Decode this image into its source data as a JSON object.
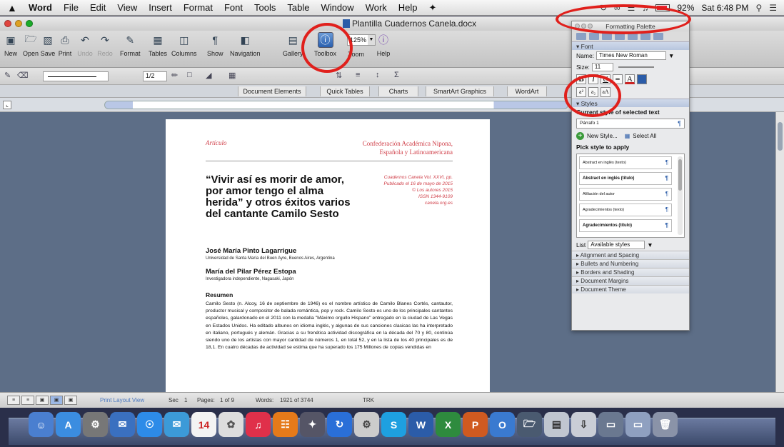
{
  "menubar": {
    "app": "Word",
    "items": [
      "File",
      "Edit",
      "View",
      "Insert",
      "Format",
      "Font",
      "Tools",
      "Table",
      "Window",
      "Work",
      "Help"
    ],
    "battery": "92%",
    "clock": "Sat 6:48 PM"
  },
  "window": {
    "title": "Plantilla Cuadernos Canela.docx"
  },
  "toolbar": {
    "new": "New",
    "open": "Open",
    "save": "Save",
    "print": "Print",
    "undo": "Undo",
    "redo": "Redo",
    "format": "Format",
    "tables": "Tables",
    "columns": "Columns",
    "show": "Show",
    "navigation": "Navigation",
    "gallery": "Gallery",
    "toolbox": "Toolbox",
    "zoom": "Zoom",
    "zoom_value": "125%",
    "help": "Help"
  },
  "fmtbar": {
    "point_size": "1/2"
  },
  "ribbon_tabs": [
    "Document Elements",
    "Quick Tables",
    "Charts",
    "SmartArt Graphics",
    "WordArt"
  ],
  "document": {
    "header_left": "Artículo",
    "header_right_1": "Confederación Académica Nipona,",
    "header_right_2": "Española y Latinoamericana",
    "title": "“Vivir así es morir de amor, por amor tengo el alma herida” y otros éxitos varios del cantante Camilo Sesto",
    "pub_1": "Cuadernos Canela Vol. XXVI, pp.",
    "pub_2": "Publicado el 16 de mayo de 2015",
    "pub_3": "© Los autores 2015",
    "pub_4": "ISSN 1344-9109",
    "pub_5": "canela.org.es",
    "author1": "José María Pinto Lagarrigue",
    "affil1": "Universidad de Santa María del Buen Ayre, Buenos Aires, Argentina",
    "author2": "María del Pilar Pérez Estopa",
    "affil2": "Investigadora independiente, Nagasaki, Japón",
    "abstract_heading": "Resumen",
    "abstract": "Camilo Sesto (n. Alcoy, 16 de septiembre de 1946) es el nombre artístico de Camilo Blanes Cortés, cantautor, productor musical y compositor de balada romántica, pop y rock. Camilo Sesto es uno de los principales cantantes españoles, galardonado en el 2011 con la medalla \"Máximo orgullo Hispano\" entregado en la ciudad de Las Vegas en Estados Unidos. Ha editado albunes en idioma inglés, y algunas de sus canciones clasicas las ha interpretado en italiano, portugués y alemán. Gracias a su frenética actividad discográfica en la década del 70 y 80, continúa siendo uno de los artistas con mayor cantidad de números 1, en total 52, y en la lista de los 40 principales es de 18,1. En cuatro décadas de actividad se estima que ha superado los 175 Millones de copias vendidas en"
  },
  "statusbar": {
    "view": "Print Layout View",
    "sec_label": "Sec",
    "sec": "1",
    "pages_label": "Pages:",
    "pages": "1 of 9",
    "words_label": "Words:",
    "words": "1921 of 3744",
    "trk": "TRK"
  },
  "palette": {
    "title": "Formatting Palette",
    "font_section": "Font",
    "name_label": "Name:",
    "font_name": "Times New Roman",
    "size_label": "Size:",
    "font_size": "11",
    "bold": "B",
    "italic": "I",
    "underline": "U",
    "styles_section": "Styles",
    "current_style_label": "Current style of selected text",
    "current_style": "Párrafo 1",
    "new_style": "New Style...",
    "select_all": "Select All",
    "pick_label": "Pick style to apply",
    "styles": [
      "Abstract en inglés (texto)",
      "Abstract en inglés (título)",
      "Afiliación del autor",
      "Agradecimientos (texto)",
      "Agradecimientos (título)"
    ],
    "list_label": "List",
    "list_value": "Available styles",
    "sections": [
      "Alignment and Spacing",
      "Bullets and Numbering",
      "Borders and Shading",
      "Document Margins",
      "Document Theme"
    ]
  },
  "colors": {
    "highlight": "#e0201c",
    "header_red": "#d0404a",
    "toolbox_blue": "#2a5fae"
  }
}
